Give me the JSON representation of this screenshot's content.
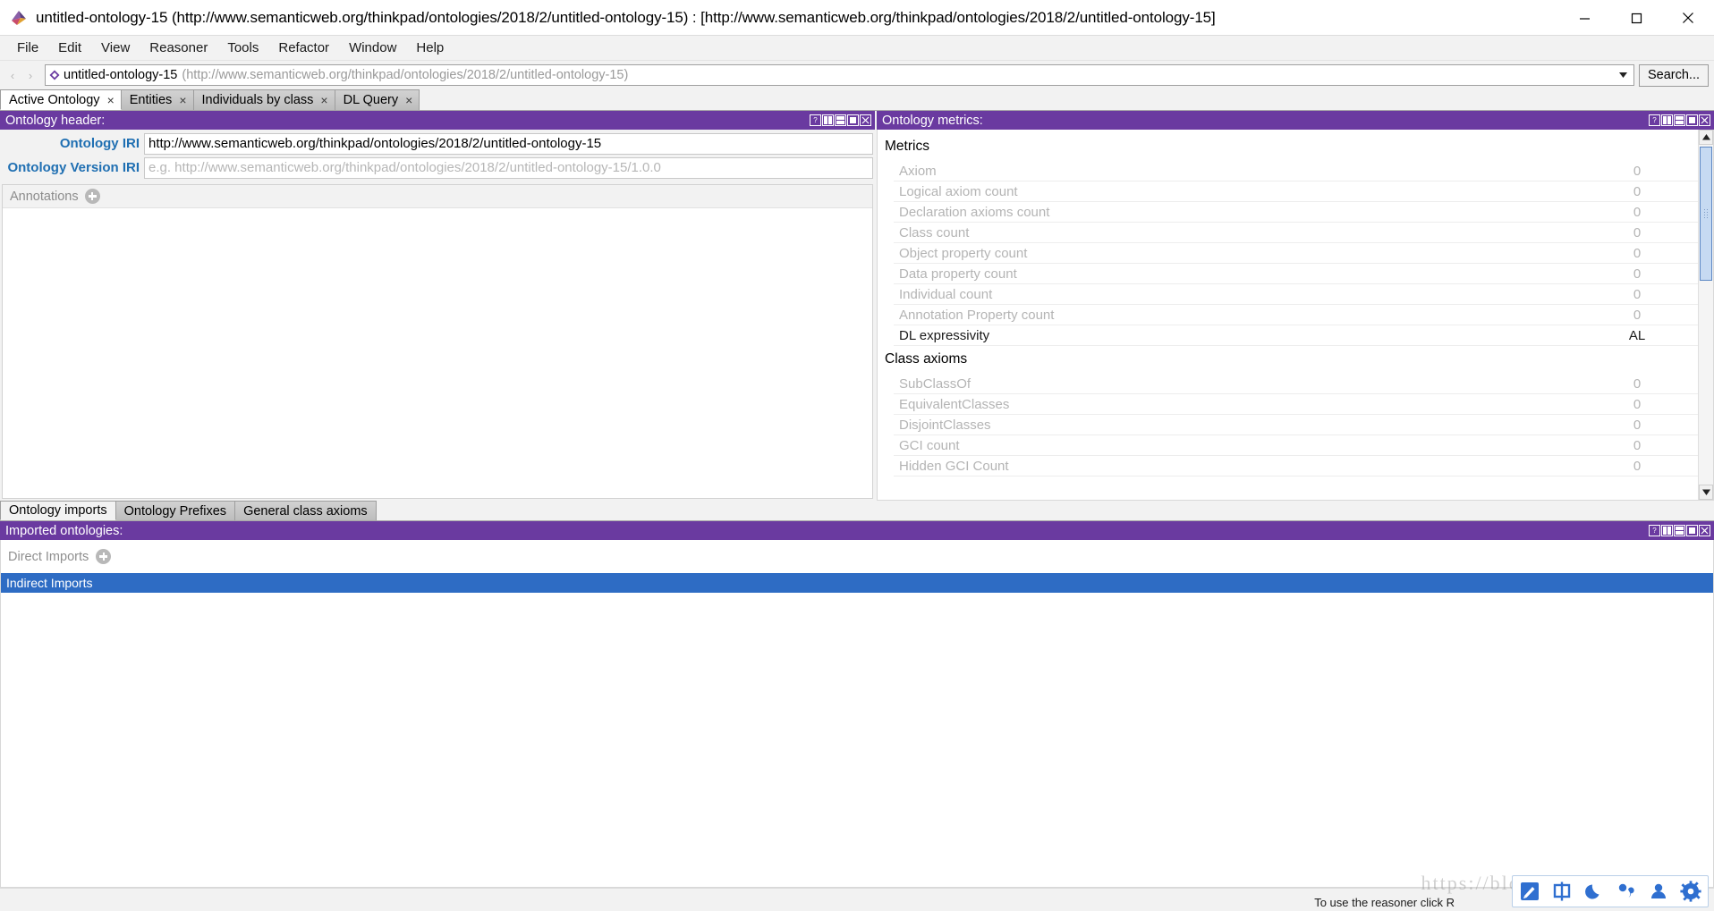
{
  "window": {
    "title": "untitled-ontology-15 (http://www.semanticweb.org/thinkpad/ontologies/2018/2/untitled-ontology-15)  : [http://www.semanticweb.org/thinkpad/ontologies/2018/2/untitled-ontology-15]",
    "app_icon": "protege-logo-icon",
    "minimize": "—",
    "maximize": "□",
    "close": "✕"
  },
  "menubar": {
    "items": [
      {
        "label": "File"
      },
      {
        "label": "Edit"
      },
      {
        "label": "View"
      },
      {
        "label": "Reasoner"
      },
      {
        "label": "Tools"
      },
      {
        "label": "Refactor"
      },
      {
        "label": "Window"
      },
      {
        "label": "Help"
      }
    ]
  },
  "toolbar": {
    "back_arrow": "‹",
    "forward_arrow": "›",
    "ontology_name": "untitled-ontology-15",
    "ontology_url": "(http://www.semanticweb.org/thinkpad/ontologies/2018/2/untitled-ontology-15)",
    "combo_arrow": "▾",
    "search_label": "Search..."
  },
  "main_tabs": [
    {
      "label": "Active Ontology",
      "close": "×",
      "active": true
    },
    {
      "label": "Entities",
      "close": "×",
      "active": false
    },
    {
      "label": "Individuals by class",
      "close": "×",
      "active": false
    },
    {
      "label": "DL Query",
      "close": "×",
      "active": false
    }
  ],
  "panel_buttons": {
    "help": "?",
    "split_vertical": "▐▌",
    "split_horizontal": "═",
    "maximize": "■",
    "close": "✕"
  },
  "ontology_header": {
    "title": "Ontology header:",
    "ontology_iri_label": "Ontology IRI",
    "ontology_iri_value": "http://www.semanticweb.org/thinkpad/ontologies/2018/2/untitled-ontology-15",
    "ontology_version_iri_label": "Ontology Version IRI",
    "ontology_version_iri_placeholder": "e.g. http://www.semanticweb.org/thinkpad/ontologies/2018/2/untitled-ontology-15/1.0.0",
    "annotations_label": "Annotations",
    "add_icon": "plus-circle-icon"
  },
  "ontology_metrics": {
    "title": "Ontology metrics:",
    "groups": [
      {
        "name": "Metrics",
        "rows": [
          {
            "label": "Axiom",
            "value": "0",
            "strong": false
          },
          {
            "label": "Logical axiom count",
            "value": "0",
            "strong": false
          },
          {
            "label": "Declaration axioms count",
            "value": "0",
            "strong": false
          },
          {
            "label": "Class count",
            "value": "0",
            "strong": false
          },
          {
            "label": "Object property count",
            "value": "0",
            "strong": false
          },
          {
            "label": "Data property count",
            "value": "0",
            "strong": false
          },
          {
            "label": "Individual count",
            "value": "0",
            "strong": false
          },
          {
            "label": "Annotation Property count",
            "value": "0",
            "strong": false
          },
          {
            "label": "DL expressivity",
            "value": "AL",
            "strong": true
          }
        ]
      },
      {
        "name": "Class axioms",
        "rows": [
          {
            "label": "SubClassOf",
            "value": "0",
            "strong": false
          },
          {
            "label": "EquivalentClasses",
            "value": "0",
            "strong": false
          },
          {
            "label": "DisjointClasses",
            "value": "0",
            "strong": false
          },
          {
            "label": "GCI count",
            "value": "0",
            "strong": false
          },
          {
            "label": "Hidden GCI Count",
            "value": "0",
            "strong": false
          }
        ]
      }
    ],
    "scroll_up": "▲",
    "scroll_down": "▼"
  },
  "lower_tabs": [
    {
      "label": "Ontology imports",
      "active": true
    },
    {
      "label": "Ontology Prefixes",
      "active": false
    },
    {
      "label": "General class axioms",
      "active": false
    }
  ],
  "imported_ontologies": {
    "title": "Imported ontologies:",
    "direct_imports_label": "Direct Imports",
    "add_icon": "plus-circle-icon",
    "indirect_imports_label": "Indirect Imports"
  },
  "statusbar": {
    "message": "To use the reasoner click R"
  },
  "watermark": {
    "text": "https://blog.csdn.net/Solitarii"
  },
  "ime_toolbar": {
    "buttons": [
      {
        "name": "ime-pen-icon"
      },
      {
        "name": "ime-chinese-icon",
        "glyph": "中"
      },
      {
        "name": "ime-moon-icon"
      },
      {
        "name": "ime-punctuation-icon"
      },
      {
        "name": "ime-user-icon"
      },
      {
        "name": "ime-settings-icon"
      }
    ]
  },
  "colors": {
    "panel_header": "#6A3AA0",
    "selection_blue": "#2E6CC4",
    "link_blue": "#1F6FB2"
  }
}
